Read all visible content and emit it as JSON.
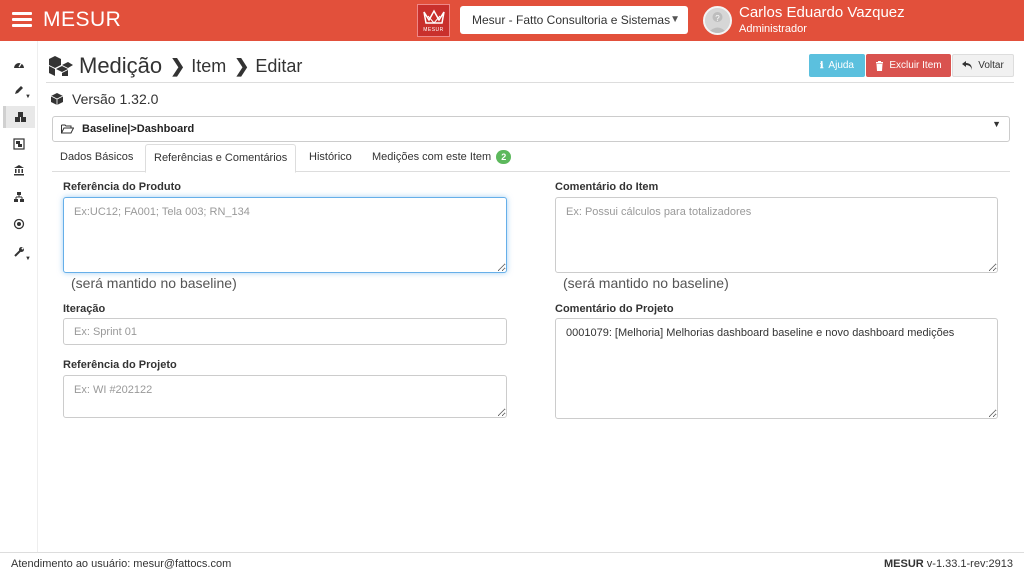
{
  "topbar": {
    "app_name": "MESUR",
    "logo_text": "MESUR",
    "org_select": "Mesur - Fatto Consultoria e Sistemas",
    "user_name": "Carlos Eduardo Vazquez",
    "user_role": "Administrador",
    "color": "#e2503b"
  },
  "sidebar": {
    "icons": [
      "dashboard-icon",
      "pencil-icon",
      "cubes-icon",
      "object-group-icon",
      "institution-icon",
      "sitemap-icon",
      "dot-circle-icon",
      "wrench-icon"
    ]
  },
  "header": {
    "title": "Medição",
    "crumb1": "Item",
    "crumb2": "Editar"
  },
  "buttons": {
    "help": "Ajuda",
    "delete": "Excluir Item",
    "back": "Voltar"
  },
  "version": "Versão 1.32.0",
  "baseline": "Baseline|>Dashboard",
  "tabs": [
    {
      "label": "Dados Básicos"
    },
    {
      "label": "Referências e Comentários"
    },
    {
      "label": "Histórico"
    },
    {
      "label": "Medições com este Item",
      "badge": "2"
    }
  ],
  "form": {
    "ref_produto": {
      "label": "Referência do Produto",
      "placeholder": "Ex:UC12; FA001; Tela 003; RN_134",
      "hint": "(será mantido no baseline)"
    },
    "comentario_item": {
      "label": "Comentário do Item",
      "placeholder": "Ex: Possui cálculos para totalizadores",
      "hint": "(será mantido no baseline)"
    },
    "iteracao": {
      "label": "Iteração",
      "placeholder": "Ex: Sprint 01"
    },
    "comentario_projeto": {
      "label": "Comentário do Projeto",
      "value": "0001079: [Melhoria] Melhorias dashboard baseline e novo dashboard medições"
    },
    "ref_projeto": {
      "label": "Referência do Projeto",
      "placeholder": "Ex: WI #202122"
    }
  },
  "footer": {
    "left": "Atendimento ao usuário: mesur@fattocs.com",
    "product": "MESUR",
    "version": " v-1.33.1-rev:2913"
  }
}
